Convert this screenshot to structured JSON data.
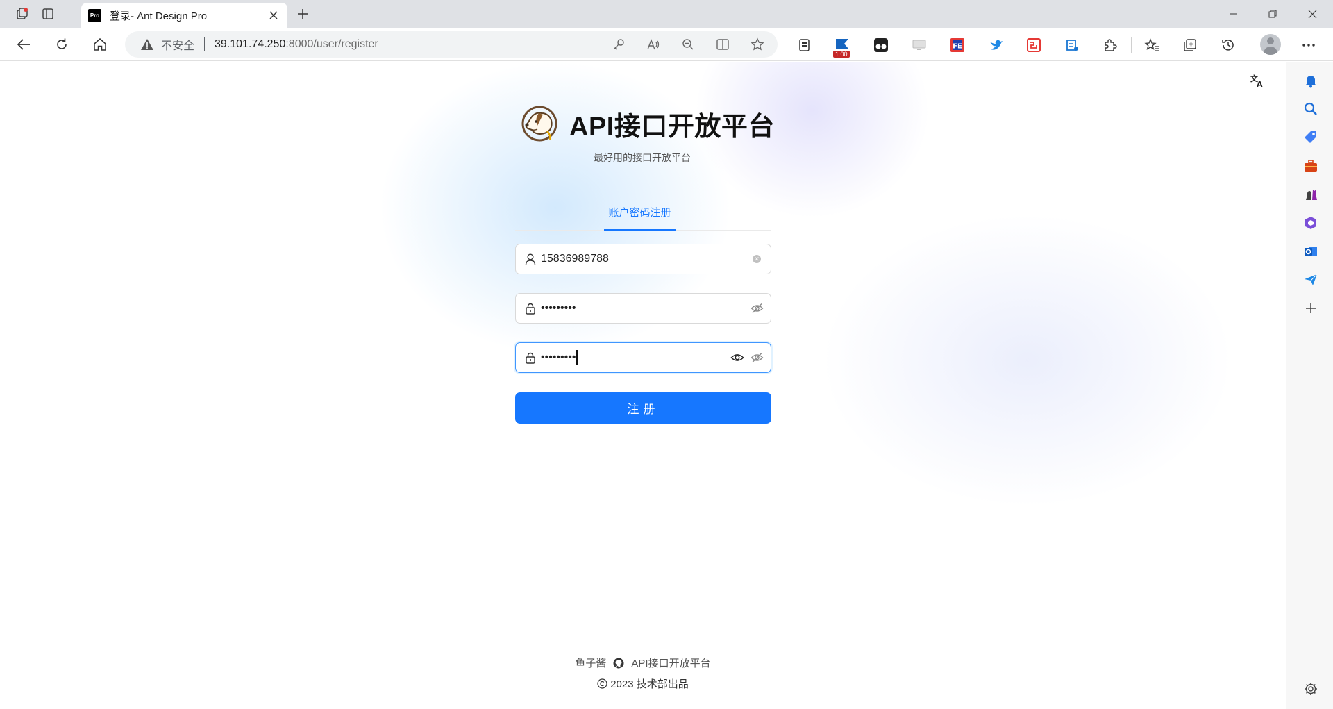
{
  "browser": {
    "tab_title": "登录- Ant Design Pro",
    "tab_favicon_text": "Pro",
    "address": {
      "insecure_label": "不安全",
      "host": "39.101.74.250",
      "path": ":8000/user/register"
    },
    "extension_badge": "1.00"
  },
  "page": {
    "app_title": "API接口开放平台",
    "app_subtitle": "最好用的接口开放平台",
    "form_tab": "账户密码注册",
    "form": {
      "account_value": "15836989788",
      "password_value": "•••••••••",
      "confirm_password_value": "•••••••••",
      "submit_label": "注册"
    },
    "footer": {
      "author": "鱼子酱",
      "project_link": "API接口开放平台",
      "copyright": "2023 技术部出品"
    }
  },
  "icons": {
    "brand_logo": "dog-logo-icon",
    "translate": "translate-icon",
    "account_prefix": "user-icon",
    "password_prefix": "lock-icon",
    "visibility": "eye-invisible-icon",
    "github": "github-icon",
    "copyright": "copyright-icon"
  },
  "colors": {
    "primary": "#1677ff",
    "focus_border": "#4096ff"
  }
}
